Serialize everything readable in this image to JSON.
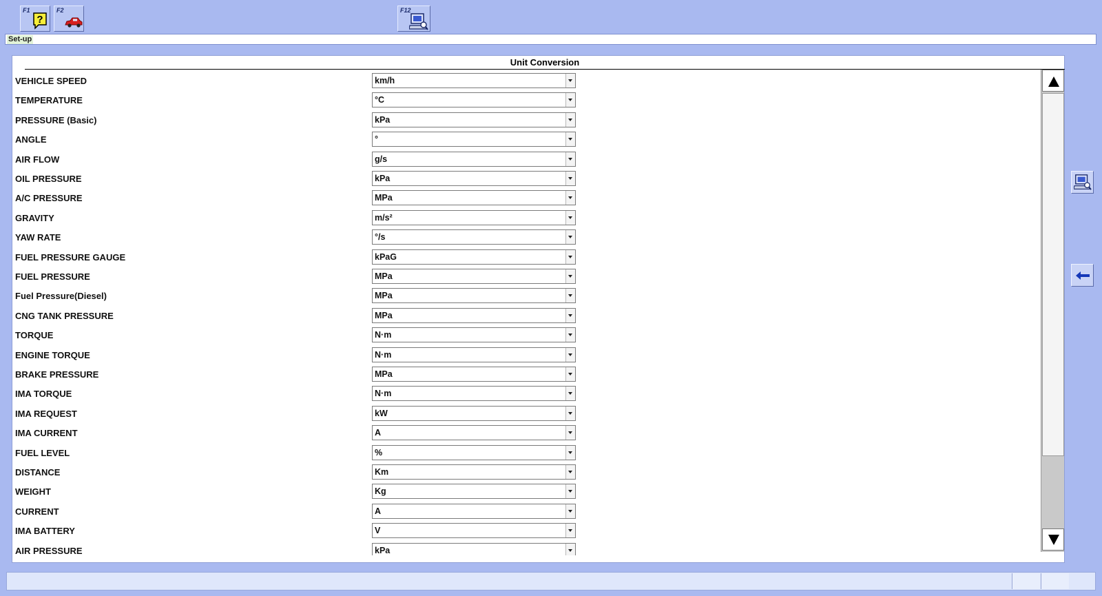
{
  "toolbar": {
    "keys": [
      {
        "key": "F1",
        "icon": "help-icon"
      },
      {
        "key": "F2",
        "icon": "car-icon"
      },
      {
        "key": "F12",
        "icon": "computer-settings-icon"
      }
    ]
  },
  "breadcrumb": {
    "text": "Set-up"
  },
  "panel": {
    "title": "Unit Conversion",
    "rows": [
      {
        "label": "VEHICLE SPEED",
        "value": "km/h"
      },
      {
        "label": "TEMPERATURE",
        "value": "°C"
      },
      {
        "label": "PRESSURE (Basic)",
        "value": "kPa"
      },
      {
        "label": "ANGLE",
        "value": "°"
      },
      {
        "label": "AIR FLOW",
        "value": "g/s"
      },
      {
        "label": "OIL PRESSURE",
        "value": "kPa"
      },
      {
        "label": "A/C PRESSURE",
        "value": "MPa"
      },
      {
        "label": "GRAVITY",
        "value": "m/s²"
      },
      {
        "label": "YAW RATE",
        "value": "°/s"
      },
      {
        "label": "FUEL PRESSURE GAUGE",
        "value": "kPaG"
      },
      {
        "label": "FUEL PRESSURE",
        "value": "MPa"
      },
      {
        "label": "Fuel Pressure(Diesel)",
        "value": "MPa"
      },
      {
        "label": "CNG TANK PRESSURE",
        "value": "MPa"
      },
      {
        "label": "TORQUE",
        "value": "N·m"
      },
      {
        "label": "ENGINE TORQUE",
        "value": "N·m"
      },
      {
        "label": "BRAKE PRESSURE",
        "value": "MPa"
      },
      {
        "label": "IMA TORQUE",
        "value": "N·m"
      },
      {
        "label": "IMA REQUEST",
        "value": "kW"
      },
      {
        "label": "IMA CURRENT",
        "value": "A"
      },
      {
        "label": "FUEL LEVEL",
        "value": "%"
      },
      {
        "label": "DISTANCE",
        "value": "Km"
      },
      {
        "label": "WEIGHT",
        "value": "Kg"
      },
      {
        "label": "CURRENT",
        "value": "A"
      },
      {
        "label": "IMA BATTERY",
        "value": "V"
      },
      {
        "label": "AIR PRESSURE",
        "value": "kPa"
      }
    ]
  },
  "side_buttons": [
    {
      "icon": "computer-settings-icon"
    },
    {
      "icon": "back-arrow-icon"
    }
  ],
  "colors": {
    "background": "#a9b9f0",
    "panel": "#ffffff",
    "breadcrumb_highlight": "#e2f3d8"
  }
}
